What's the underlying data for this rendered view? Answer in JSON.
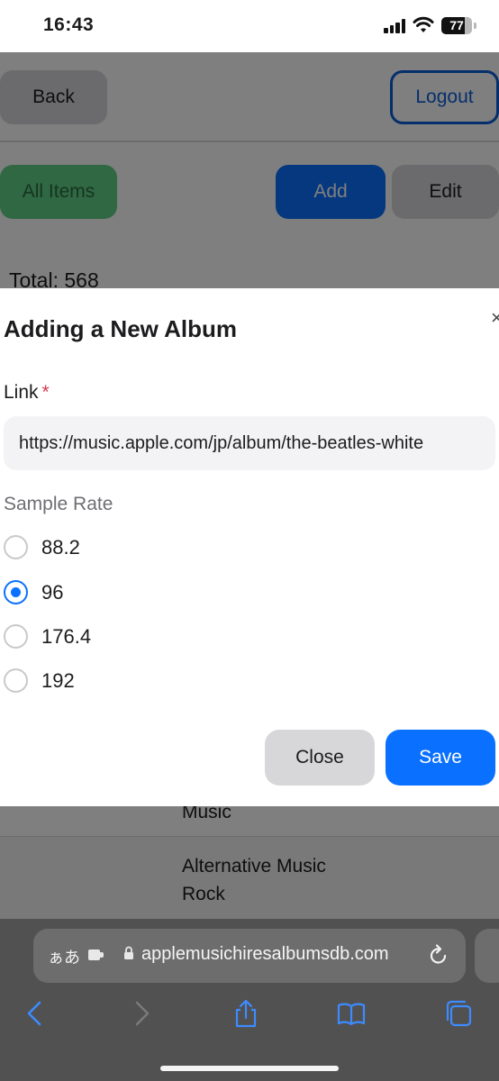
{
  "status_bar": {
    "time": "16:43",
    "battery": "77"
  },
  "app": {
    "back_label": "Back",
    "logout_label": "Logout",
    "all_items_label": "All Items",
    "add_label": "Add",
    "edit_label": "Edit",
    "total_text": "Total: 568",
    "genre_row_1": "Music",
    "genre_row_2": "Alternative Music Rock"
  },
  "modal": {
    "title": "Adding a New Album",
    "close_glyph": "×",
    "link_label": "Link",
    "required_mark": "*",
    "link_value": "https://music.apple.com/jp/album/the-beatles-white",
    "sample_rate_label": "Sample Rate",
    "sample_rates": [
      {
        "label": "88.2",
        "checked": false
      },
      {
        "label": "96",
        "checked": true
      },
      {
        "label": "176.4",
        "checked": false
      },
      {
        "label": "192",
        "checked": false
      }
    ],
    "close_label": "Close",
    "save_label": "Save"
  },
  "safari": {
    "aa_label": "ぁあ",
    "url": "applemusichiresalbumsdb.com"
  },
  "colors": {
    "accent_blue": "#0a70ff",
    "green_button": "#5fd184",
    "required_red": "#d33a4f"
  }
}
